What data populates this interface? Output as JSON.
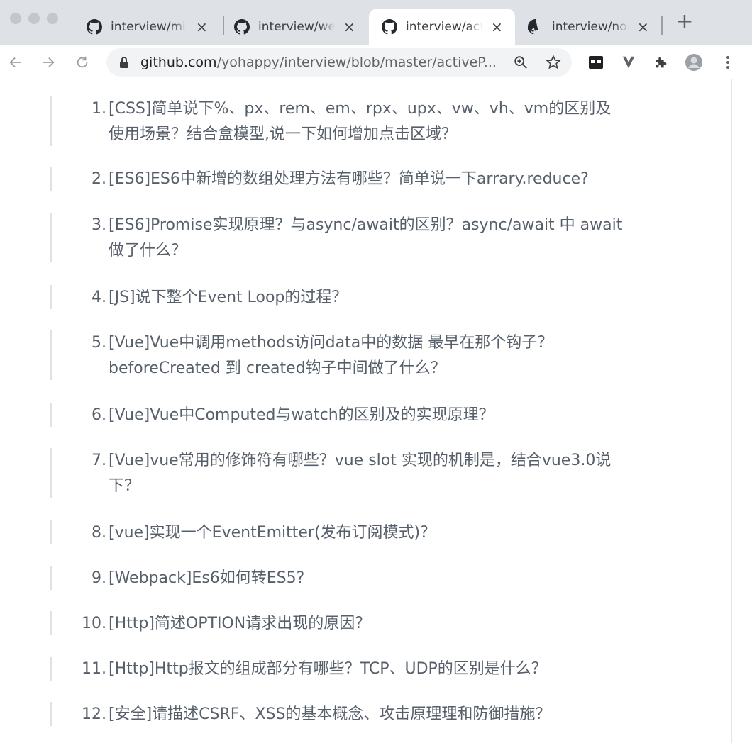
{
  "browser": {
    "tabs": [
      {
        "title": "interview/mini",
        "close": "×"
      },
      {
        "title": "interview/web",
        "close": "×"
      },
      {
        "title": "interview/activ",
        "close": "×"
      },
      {
        "title": "interview/node",
        "close": "×"
      }
    ],
    "active_tab_index": 2,
    "new_tab_label": "+",
    "address": {
      "host": "github.com",
      "path": "/yohappy/interview/blob/master/activeP..."
    }
  },
  "questions": [
    {
      "num": "1.",
      "lines": [
        "[CSS]简单说下%、px、rem、em、rpx、upx、vw、vh、vm的区别及",
        "使用场景？结合盒模型,说一下如何增加点击区域？"
      ]
    },
    {
      "num": "2.",
      "lines": [
        "[ES6]ES6中新增的数组处理方法有哪些？简单说一下arrary.reduce?"
      ]
    },
    {
      "num": "3.",
      "lines": [
        "[ES6]Promise实现原理？与async/await的区别？async/await 中 await",
        "做了什么？"
      ]
    },
    {
      "num": "4.",
      "lines": [
        "[JS]说下整个Event Loop的过程？"
      ]
    },
    {
      "num": "5.",
      "lines": [
        "[Vue]Vue中调用methods访问data中的数据 最早在那个钩子？",
        "beforeCreated 到 created钩子中间做了什么？"
      ]
    },
    {
      "num": "6.",
      "lines": [
        "[Vue]Vue中Computed与watch的区别及的实现原理？"
      ]
    },
    {
      "num": "7.",
      "lines": [
        "[Vue]vue常用的修饰符有哪些？vue slot 实现的机制是，结合vue3.0说",
        "下？"
      ]
    },
    {
      "num": "8.",
      "lines": [
        "[vue]实现一个EventEmitter(发布订阅模式)？"
      ]
    },
    {
      "num": "9.",
      "lines": [
        "[Webpack]Es6如何转ES5?"
      ]
    },
    {
      "num": "10.",
      "lines": [
        "[Http]简述OPTION请求出现的原因？"
      ]
    },
    {
      "num": "11.",
      "lines": [
        "[Http]Http报文的组成部分有哪些？TCP、UDP的区别是什么？"
      ]
    },
    {
      "num": "12.",
      "lines": [
        "[安全]请描述CSRF、XSS的基本概念、攻击原理理和防御措施？"
      ]
    }
  ],
  "colors": {
    "tabstrip": "#dee1e6",
    "quote_bar": "#dfe2e5",
    "text": "#57606a"
  }
}
